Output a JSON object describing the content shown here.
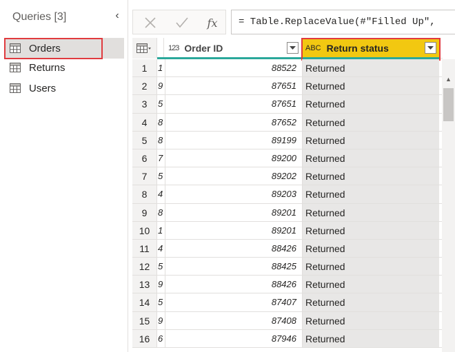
{
  "queries": {
    "title": "Queries [3]",
    "items": [
      {
        "label": "Orders",
        "selected": true
      },
      {
        "label": "Returns",
        "selected": false
      },
      {
        "label": "Users",
        "selected": false
      }
    ]
  },
  "formula_bar": {
    "fx": "fx",
    "formula": "= Table.ReplaceValue(#\"Filled Up\", "
  },
  "grid": {
    "columns": [
      {
        "type_icon": "123",
        "name": "Order ID"
      },
      {
        "type_icon": "ABC",
        "name": "Return status"
      }
    ],
    "rows": [
      {
        "n": "1",
        "prev": "1",
        "order_id": "88522",
        "status": "Returned"
      },
      {
        "n": "2",
        "prev": "9",
        "order_id": "87651",
        "status": "Returned"
      },
      {
        "n": "3",
        "prev": "5",
        "order_id": "87651",
        "status": "Returned"
      },
      {
        "n": "4",
        "prev": "8",
        "order_id": "87652",
        "status": "Returned"
      },
      {
        "n": "5",
        "prev": "8",
        "order_id": "89199",
        "status": "Returned"
      },
      {
        "n": "6",
        "prev": "7",
        "order_id": "89200",
        "status": "Returned"
      },
      {
        "n": "7",
        "prev": "5",
        "order_id": "89202",
        "status": "Returned"
      },
      {
        "n": "8",
        "prev": "4",
        "order_id": "89203",
        "status": "Returned"
      },
      {
        "n": "9",
        "prev": "8",
        "order_id": "89201",
        "status": "Returned"
      },
      {
        "n": "10",
        "prev": "1",
        "order_id": "89201",
        "status": "Returned"
      },
      {
        "n": "11",
        "prev": "4",
        "order_id": "88426",
        "status": "Returned"
      },
      {
        "n": "12",
        "prev": "5",
        "order_id": "88425",
        "status": "Returned"
      },
      {
        "n": "13",
        "prev": "9",
        "order_id": "88426",
        "status": "Returned"
      },
      {
        "n": "14",
        "prev": "5",
        "order_id": "87407",
        "status": "Returned"
      },
      {
        "n": "15",
        "prev": "9",
        "order_id": "87408",
        "status": "Returned"
      },
      {
        "n": "16",
        "prev": "6",
        "order_id": "87946",
        "status": "Returned"
      }
    ]
  },
  "colors": {
    "selected_header": "#f2c811",
    "highlight_outline": "#e03a3e",
    "quality_bar": "#2aa89a"
  }
}
